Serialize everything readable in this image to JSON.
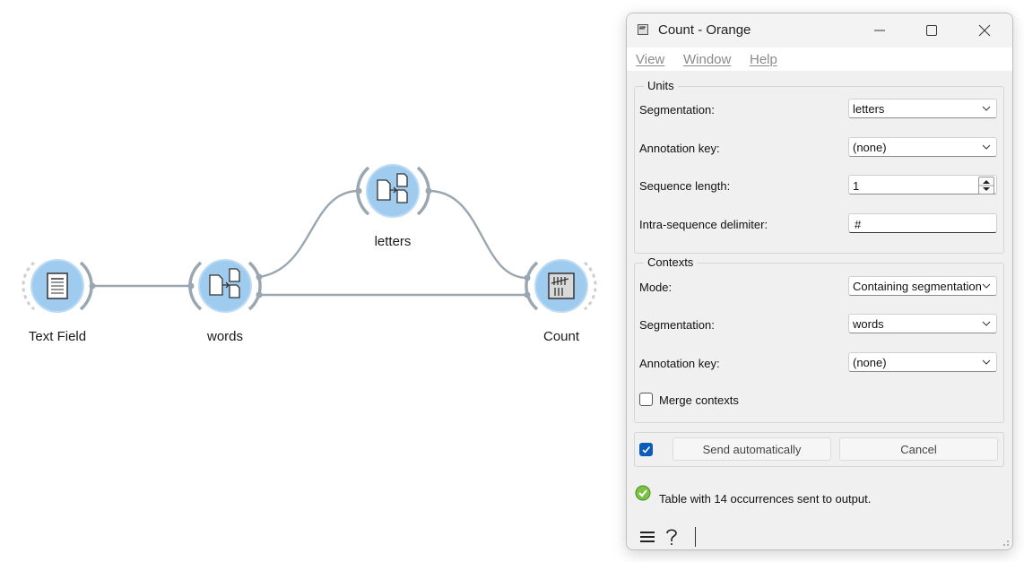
{
  "canvas": {
    "nodes": [
      {
        "id": "text-field",
        "label": "Text Field",
        "icon": "document-icon"
      },
      {
        "id": "words",
        "label": "words",
        "icon": "segment-icon"
      },
      {
        "id": "letters",
        "label": "letters",
        "icon": "segment-icon"
      },
      {
        "id": "count",
        "label": "Count",
        "icon": "tally-icon"
      }
    ]
  },
  "window": {
    "title": "Count - Orange",
    "menu": [
      "View",
      "Window",
      "Help"
    ],
    "units": {
      "title": "Units",
      "segmentation_label": "Segmentation:",
      "segmentation_value": "letters",
      "annotation_label": "Annotation key:",
      "annotation_value": "(none)",
      "seq_length_label": "Sequence length:",
      "seq_length_value": "1",
      "delimiter_label": "Intra-sequence delimiter:",
      "delimiter_value": "#"
    },
    "contexts": {
      "title": "Contexts",
      "mode_label": "Mode:",
      "mode_value": "Containing segmentation",
      "segmentation_label": "Segmentation:",
      "segmentation_value": "words",
      "annotation_label": "Annotation key:",
      "annotation_value": "(none)",
      "merge_label": "Merge contexts",
      "merge_checked": false
    },
    "actions": {
      "auto_checked": true,
      "send_label": "Send automatically",
      "cancel_label": "Cancel"
    },
    "status": {
      "icon": "check-circle-icon",
      "text": "Table with 14 occurrences sent to output."
    },
    "bottom": {
      "menu_icon": "hamburger-icon",
      "help_icon": "question-icon"
    }
  }
}
